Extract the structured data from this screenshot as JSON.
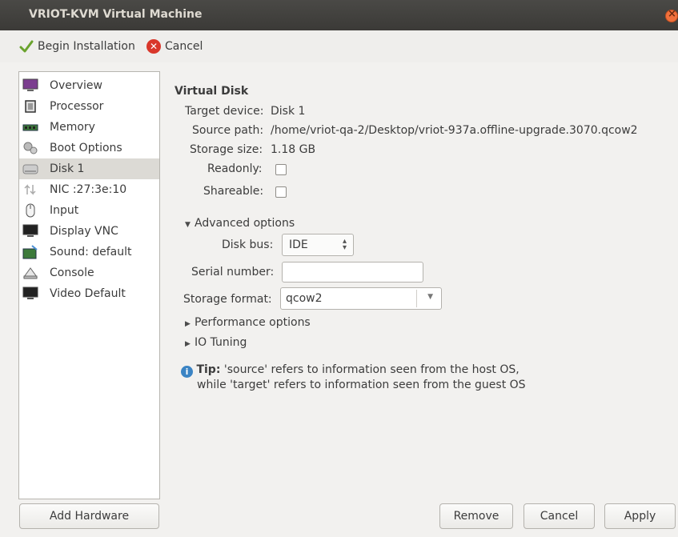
{
  "window": {
    "title": "VRIOT-KVM Virtual Machine"
  },
  "toolbar": {
    "begin_label": "Begin Installation",
    "cancel_label": "Cancel"
  },
  "sidebar": {
    "items": [
      {
        "label": "Overview",
        "icon": "monitor-icon"
      },
      {
        "label": "Processor",
        "icon": "cpu-icon"
      },
      {
        "label": "Memory",
        "icon": "memory-icon"
      },
      {
        "label": "Boot Options",
        "icon": "gears-icon"
      },
      {
        "label": "Disk 1",
        "icon": "disk-icon",
        "selected": true
      },
      {
        "label": "NIC :27:3e:10",
        "icon": "network-icon"
      },
      {
        "label": "Input",
        "icon": "mouse-icon"
      },
      {
        "label": "Display VNC",
        "icon": "display-icon"
      },
      {
        "label": "Sound: default",
        "icon": "sound-icon"
      },
      {
        "label": "Console",
        "icon": "console-icon"
      },
      {
        "label": "Video Default",
        "icon": "video-icon"
      }
    ]
  },
  "details": {
    "section_title": "Virtual Disk",
    "target_device_label": "Target device:",
    "target_device_value": "Disk 1",
    "source_path_label": "Source path:",
    "source_path_value": "/home/vriot-qa-2/Desktop/vriot-937a.offline-upgrade.3070.qcow2",
    "storage_size_label": "Storage size:",
    "storage_size_value": "1.18 GB",
    "readonly_label": "Readonly:",
    "shareable_label": "Shareable:",
    "advanced_label": "Advanced options",
    "disk_bus_label": "Disk bus:",
    "disk_bus_value": "IDE",
    "serial_label": "Serial number:",
    "serial_value": "",
    "storage_format_label": "Storage format:",
    "storage_format_value": "qcow2",
    "performance_label": "Performance options",
    "io_tuning_label": "IO Tuning",
    "tip_bold": "Tip:",
    "tip_text1": " 'source' refers to information seen from the host OS,",
    "tip_text2": "while 'target' refers to information seen from the guest OS"
  },
  "buttons": {
    "add_hardware": "Add Hardware",
    "remove": "Remove",
    "cancel": "Cancel",
    "apply": "Apply"
  }
}
